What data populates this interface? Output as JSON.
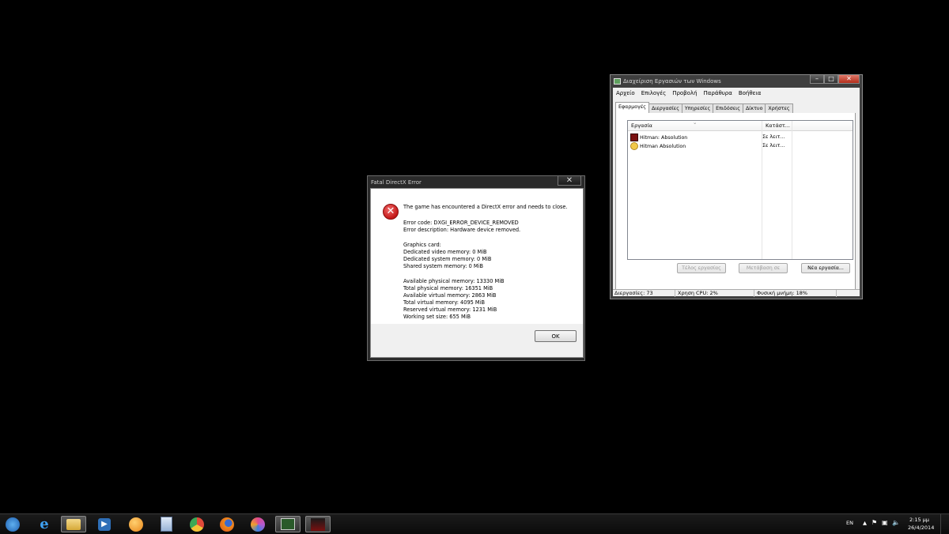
{
  "error_dialog": {
    "title": "Fatal DirectX Error",
    "close_label": "✕",
    "lines": [
      "The game has encountered a DirectX error and needs to close.",
      "Error code: DXGI_ERROR_DEVICE_REMOVED",
      "Error description: Hardware device removed.",
      "Graphics card:",
      "Dedicated video memory: 0 MiB",
      "Dedicated system memory: 0 MiB",
      "Shared system memory: 0 MiB",
      "Available physical memory: 13330 MiB",
      "Total physical memory: 16351 MiB",
      "Available virtual memory: 2863 MiB",
      "Total virtual memory: 4095 MiB",
      "Reserved virtual memory: 1231 MiB",
      "Working set size: 655 MiB"
    ],
    "ok_label": "OK"
  },
  "task_manager": {
    "title": "Διαχείριση Εργασιών των Windows",
    "menu": [
      "Αρχείο",
      "Επιλογές",
      "Προβολή",
      "Παράθυρα",
      "Βοήθεια"
    ],
    "tabs": [
      "Εφαρμογές",
      "Διεργασίες",
      "Υπηρεσίες",
      "Επιδόσεις",
      "Δίκτυο",
      "Χρήστες"
    ],
    "active_tab": "Εφαρμογές",
    "columns": [
      "Εργασία",
      "Κατάστ..."
    ],
    "rows": [
      {
        "task": "Hitman: Absolution",
        "status": "Σε λειτ..."
      },
      {
        "task": "Hitman Absolution",
        "status": "Σε λειτ..."
      }
    ],
    "buttons": {
      "end_task": "Τέλος εργασίας",
      "switch_to": "Μετάβαση σε",
      "new_task": "Νέα εργασία..."
    },
    "status": {
      "processes": "Διεργασίες: 73",
      "cpu": "Χρηση CPU: 2%",
      "memory": "Φυσική μνήμη: 18%"
    }
  },
  "taskbar": {
    "items": [
      {
        "name": "windows-start",
        "color": "#2d7fd8"
      },
      {
        "name": "internet-explorer",
        "color": "#2b8fe0"
      },
      {
        "name": "file-explorer",
        "color": "#e8c25a"
      },
      {
        "name": "media-player",
        "color": "#3a7fd0"
      },
      {
        "name": "orange-ball-app",
        "color": "#f09a1c"
      },
      {
        "name": "calculator",
        "color": "#8fb0d8"
      },
      {
        "name": "chrome",
        "color": "#e04a3a"
      },
      {
        "name": "firefox",
        "color": "#e8761c"
      },
      {
        "name": "swirl-app",
        "color": "#b45ad0"
      },
      {
        "name": "task-manager",
        "color": "#5ea05e"
      },
      {
        "name": "hitman-game",
        "color": "#8a1a1a"
      }
    ],
    "tray": {
      "language": "EN",
      "time": "2:15 μμ",
      "date": "26/4/2014"
    }
  }
}
